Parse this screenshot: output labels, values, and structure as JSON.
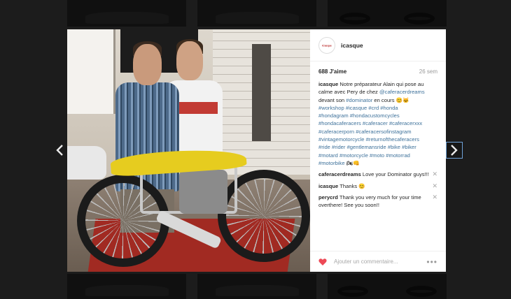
{
  "post": {
    "username": "icasque",
    "avatar_text": "iCasque",
    "likes": "688 J'aime",
    "time": "26 sem"
  },
  "caption": {
    "author": "icasque",
    "parts": [
      {
        "t": "Notre préparateur Alain qui pose au calme avec Pery de chez "
      },
      {
        "t": "@caferacerdreams",
        "tag": true
      },
      {
        "t": " devant son "
      },
      {
        "t": "#dominator",
        "tag": true
      },
      {
        "t": " en cours 😊🐱 "
      },
      {
        "t": "#workshop",
        "tag": true
      },
      {
        "t": " "
      },
      {
        "t": "#icasque",
        "tag": true
      },
      {
        "t": " "
      },
      {
        "t": "#crd",
        "tag": true
      },
      {
        "t": " "
      },
      {
        "t": "#honda",
        "tag": true
      },
      {
        "t": " "
      },
      {
        "t": "#hondagram",
        "tag": true
      },
      {
        "t": " "
      },
      {
        "t": "#hondacustomcycles",
        "tag": true
      },
      {
        "t": " "
      },
      {
        "t": "#hondacaferacers",
        "tag": true
      },
      {
        "t": " "
      },
      {
        "t": "#caferacer",
        "tag": true
      },
      {
        "t": " "
      },
      {
        "t": "#caferacerxxx",
        "tag": true
      },
      {
        "t": " "
      },
      {
        "t": "#caferacerporn",
        "tag": true
      },
      {
        "t": " "
      },
      {
        "t": "#caferacersofinstagram",
        "tag": true
      },
      {
        "t": " "
      },
      {
        "t": "#vintagemotorcycle",
        "tag": true
      },
      {
        "t": " "
      },
      {
        "t": "#returnofthecaferacers",
        "tag": true
      },
      {
        "t": " "
      },
      {
        "t": "#ride",
        "tag": true
      },
      {
        "t": " "
      },
      {
        "t": "#rider",
        "tag": true
      },
      {
        "t": " "
      },
      {
        "t": "#gentlemansride",
        "tag": true
      },
      {
        "t": " "
      },
      {
        "t": "#bike",
        "tag": true
      },
      {
        "t": " "
      },
      {
        "t": "#biker",
        "tag": true
      },
      {
        "t": " "
      },
      {
        "t": "#motard",
        "tag": true
      },
      {
        "t": " "
      },
      {
        "t": "#motorcycle",
        "tag": true
      },
      {
        "t": " "
      },
      {
        "t": "#moto",
        "tag": true
      },
      {
        "t": " "
      },
      {
        "t": "#motorrad",
        "tag": true
      },
      {
        "t": " "
      },
      {
        "t": "#motorbike",
        "tag": true
      },
      {
        "t": " 🏍👊"
      }
    ]
  },
  "comments": [
    {
      "author": "caferacerdreams",
      "text": "Love your Dominator guys!!!",
      "delete": "✕"
    },
    {
      "author": "icasque",
      "text": "Thanks 😊",
      "delete": "✕"
    },
    {
      "author": "perycrd",
      "text": "Thank you very much for your time overthere! See you soon!!",
      "delete": "✕"
    }
  ],
  "footer": {
    "comment_placeholder": "Ajouter un commentaire...",
    "more_label": "•••"
  },
  "colors": {
    "accent_link": "#3f729b",
    "like_heart": "#ed4956"
  },
  "icons": {
    "prev": "chevron-left-icon",
    "next": "chevron-right-icon",
    "like": "heart-icon",
    "more": "ellipsis-icon"
  }
}
